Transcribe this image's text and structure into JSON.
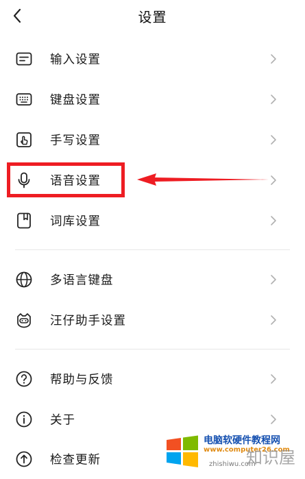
{
  "header": {
    "title": "设置",
    "back_icon": "chevron-left-icon"
  },
  "menu_groups": [
    {
      "items": [
        {
          "label": "输入设置",
          "icon": "input-box-icon"
        },
        {
          "label": "键盘设置",
          "icon": "keyboard-icon"
        },
        {
          "label": "手写设置",
          "icon": "handwriting-icon"
        },
        {
          "label": "语音设置",
          "icon": "microphone-icon"
        },
        {
          "label": "词库设置",
          "icon": "dictionary-icon"
        }
      ]
    },
    {
      "items": [
        {
          "label": "多语言键盘",
          "icon": "globe-icon"
        },
        {
          "label": "汪仔助手设置",
          "icon": "assistant-mascot-icon"
        }
      ]
    },
    {
      "items": [
        {
          "label": "帮助与反馈",
          "icon": "help-circle-icon"
        },
        {
          "label": "关于",
          "icon": "info-circle-icon"
        },
        {
          "label": "检查更新",
          "icon": "upload-circle-icon"
        }
      ]
    }
  ],
  "annotation": {
    "highlight_target": "语音设置",
    "color": "#ee1d23"
  },
  "watermark": {
    "title": "电脑软硬件教程网",
    "url": "www.computer26.com",
    "logo_text": "知识屋",
    "pinyin": "zhishiwu.com"
  }
}
